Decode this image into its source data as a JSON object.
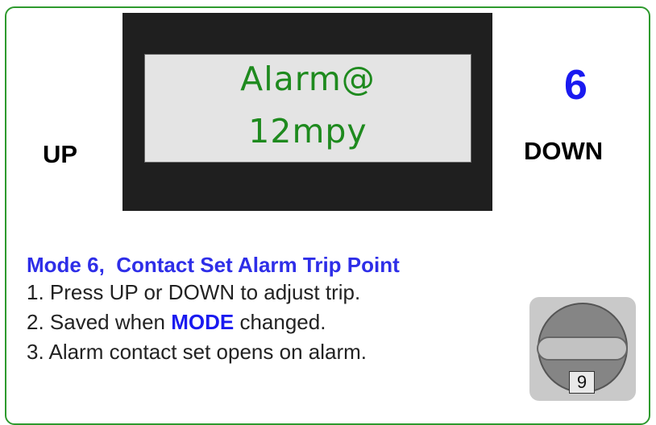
{
  "display": {
    "line1": "Alarm@",
    "line2": "12mpy"
  },
  "buttons": {
    "up_label": "UP",
    "down_label": "DOWN"
  },
  "mode_number": "6",
  "instructions": {
    "heading": "Mode 6,  Contact Set Alarm Trip Point",
    "step1": "1. Press UP or DOWN to adjust trip.",
    "step2_prefix": "2. Saved when ",
    "step2_keyword": "MODE",
    "step2_suffix": " changed.",
    "step3": "3. Alarm contact set opens on alarm."
  },
  "knob": {
    "label": "9"
  },
  "colors": {
    "border_green": "#2e9a2e",
    "lcd_text_green": "#1e8a1e",
    "accent_blue": "#1a1af0",
    "lcd_bezel": "#1f1f1f",
    "lcd_screen": "#e4e4e4"
  }
}
